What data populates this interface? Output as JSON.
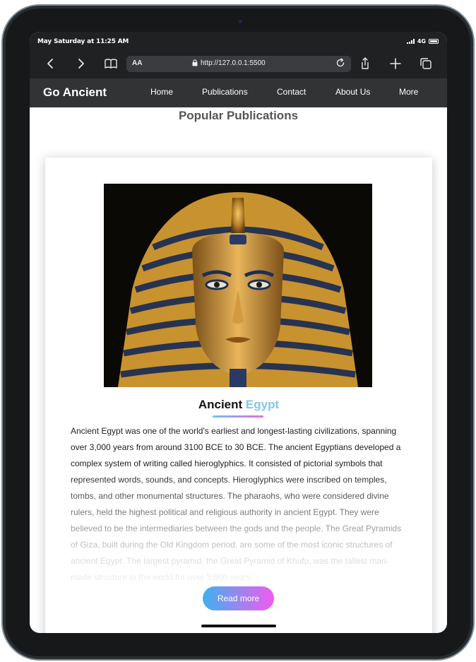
{
  "status_bar": {
    "time": "May Saturday at 11:25 AM",
    "network": "4G"
  },
  "browser": {
    "text_size_label": "AA",
    "url": "http://127.0.0.1:5500",
    "back_icon": "chevron-left-icon",
    "forward_icon": "chevron-right-icon",
    "bookmarks_icon": "book-icon",
    "share_icon": "share-icon",
    "new_tab_icon": "plus-icon",
    "tabs_icon": "tabs-icon",
    "reload_icon": "reload-icon",
    "lock_icon": "lock-icon"
  },
  "site_nav": {
    "brand": "Go Ancient",
    "links": [
      "Home",
      "Publications",
      "Contact",
      "About Us",
      "More"
    ]
  },
  "section_title": "Popular Publications",
  "article": {
    "image_alt": "Golden funerary mask of Tutankhamun",
    "heading_main": "Ancient",
    "heading_accent": "Egypt",
    "body": "Ancient Egypt was one of the world's earliest and longest-lasting civilizations, spanning over 3,000 years from around 3100 BCE to 30 BCE. The ancient Egyptians developed a complex system of writing called hieroglyphics. It consisted of pictorial symbols that represented words, sounds, and concepts. Hieroglyphics were inscribed on temples, tombs, and other monumental structures. The pharaohs, who were considered divine rulers, held the highest political and religious authority in ancient Egypt. They were believed to be the intermediaries between the gods and the people. The Great Pyramids of Giza, built during the Old Kingdom period, are some of the most iconic structures of ancient Egypt. The largest pyramid, the Great Pyramid of Khufu, was the tallest man-made structure in the world for over 3,800 years.",
    "read_more_label": "Read more"
  },
  "colors": {
    "nav_background": "#313335",
    "heading_accent": "#86c6e6",
    "button_gradient_start": "#3fb1ef",
    "button_gradient_end": "#f25bef"
  }
}
